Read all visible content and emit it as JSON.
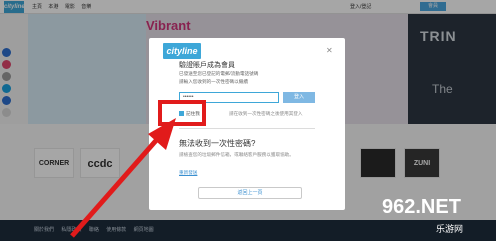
{
  "site": {
    "logo_text": "cityline",
    "nav": [
      "主頁",
      "本港",
      "電影",
      "音樂"
    ],
    "top_right": "登入/登記",
    "signup_label": "會員",
    "banner_text": "Vibrant",
    "trin_text": "TRIN",
    "the_text": "The",
    "social_colors": [
      "#2d6fd0",
      "#e0486d",
      "#9b9b9b",
      "#1aa1e0",
      "#2d6fd0",
      "#d8d8d8"
    ],
    "logos": [
      "CORNER",
      "ccdc",
      "ZUNI"
    ],
    "footer_links": [
      "關於我們",
      "私隱政策",
      "聯絡",
      "使用條款",
      "網頁地圖"
    ]
  },
  "modal": {
    "logo": "cityline",
    "title": "驗證賬戶成為會員",
    "desc_1": "已發送至您已登記的電郵/流動電話號碼",
    "desc_2": "請輸入您收到的一次性密碼以繼續",
    "password_value": "••••••",
    "login_label": "登入",
    "remember_label": "記住我",
    "hint": "請在收到一次性密碼之後使用其登入",
    "no_code_title": "無法收到一次性密碼?",
    "no_code_desc": "請檢查您的垃圾郵件信箱，或聯絡客戶服務以獲取協助。",
    "resend_link": "重新發送",
    "back_label": "返回上一頁"
  },
  "watermark": {
    "main": "962.NET",
    "sub": "乐游网"
  }
}
